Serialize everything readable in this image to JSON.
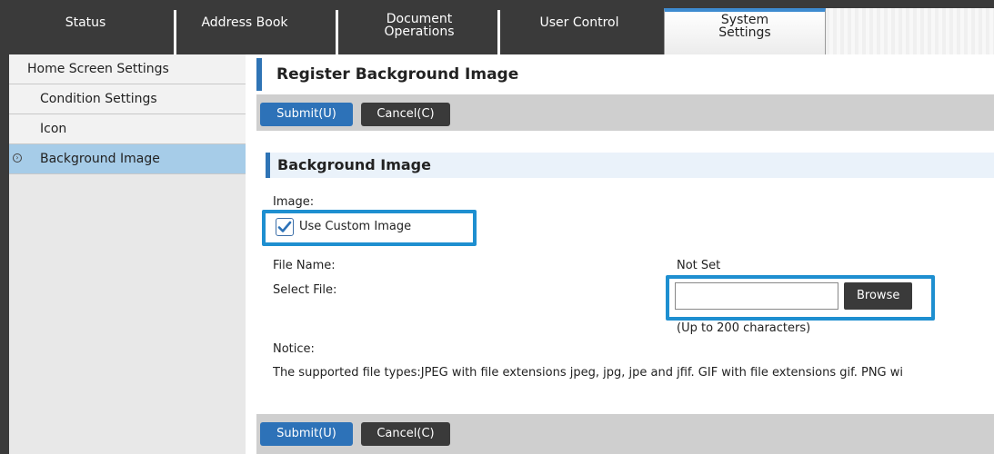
{
  "tabs": [
    {
      "label": "Status"
    },
    {
      "label": "Address Book"
    },
    {
      "label": "Document Operations"
    },
    {
      "label": "User Control"
    },
    {
      "label": "System Settings",
      "active": true
    }
  ],
  "sidebar": {
    "items": [
      {
        "label": "Home Screen Settings"
      },
      {
        "label": "Condition Settings"
      },
      {
        "label": "Icon"
      },
      {
        "label": "Background Image",
        "active": true
      }
    ]
  },
  "main": {
    "title": "Register Background Image",
    "submit_label": "Submit(U)",
    "cancel_label": "Cancel(C)",
    "section_title": "Background Image",
    "image_label": "Image:",
    "use_custom_image_label": "Use Custom Image",
    "use_custom_image_checked": true,
    "file_name_label": "File Name:",
    "file_name_value": "Not Set",
    "select_file_label": "Select File:",
    "select_file_value": "",
    "browse_label": "Browse",
    "char_limit_hint": "(Up to 200 characters)",
    "notice_label": "Notice:",
    "notice_text": "The supported file types:JPEG with file extensions jpeg, jpg, jpe and jfif. GIF with file extensions gif. PNG wi"
  },
  "colors": {
    "accent": "#2d72b8",
    "highlight_border": "#1e8fd0",
    "sidebar_active": "#a6cce8",
    "tabbar": "#3a3a3a"
  }
}
